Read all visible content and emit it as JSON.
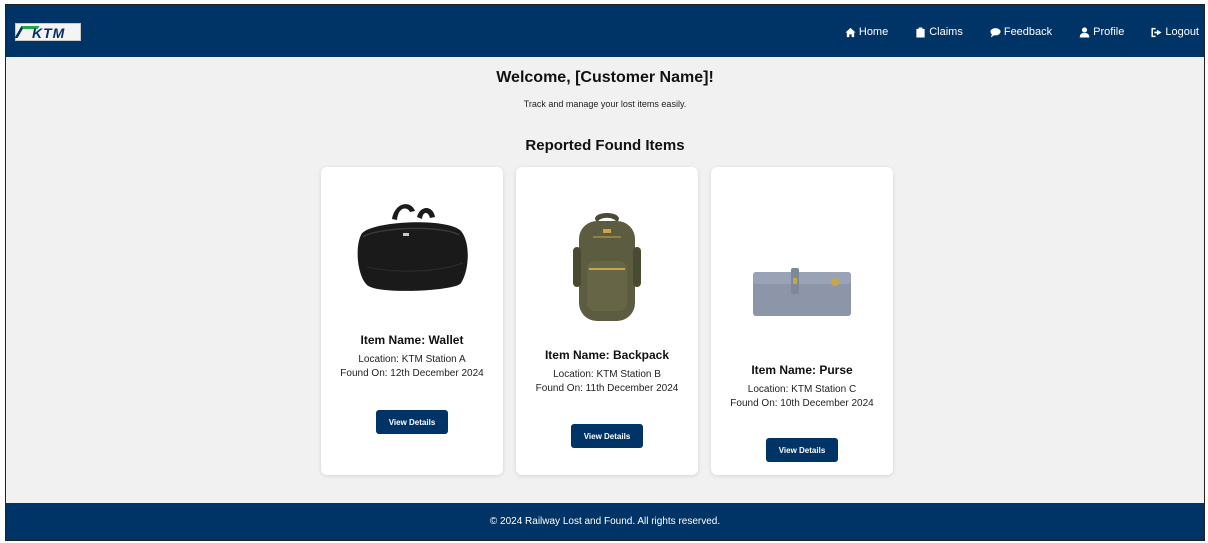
{
  "header": {
    "logo_text": "KTM",
    "nav": [
      {
        "label": "Home",
        "icon": "home-icon"
      },
      {
        "label": "Claims",
        "icon": "clipboard-icon"
      },
      {
        "label": "Feedback",
        "icon": "chat-icon"
      },
      {
        "label": "Profile",
        "icon": "user-icon"
      },
      {
        "label": "Logout",
        "icon": "logout-icon"
      }
    ]
  },
  "main": {
    "welcome": "Welcome, [Customer Name]!",
    "tagline": "Track and manage your lost items easily.",
    "section_title": "Reported Found Items",
    "items": [
      {
        "name": "Item Name: Wallet",
        "location": "Location: KTM Station A",
        "found_on": "Found On: 12th December 2024",
        "button": "View Details",
        "image": "duffel-bag"
      },
      {
        "name": "Item Name: Backpack",
        "location": "Location: KTM Station B",
        "found_on": "Found On: 11th December 2024",
        "button": "View Details",
        "image": "backpack"
      },
      {
        "name": "Item Name: Purse",
        "location": "Location: KTM Station C",
        "found_on": "Found On: 10th December 2024",
        "button": "View Details",
        "image": "purse"
      }
    ]
  },
  "footer": {
    "text": "© 2024 Railway Lost and Found. All rights reserved."
  },
  "colors": {
    "navbar": "#003366",
    "page_background": "#f1f1f1",
    "card_background": "#ffffff"
  }
}
